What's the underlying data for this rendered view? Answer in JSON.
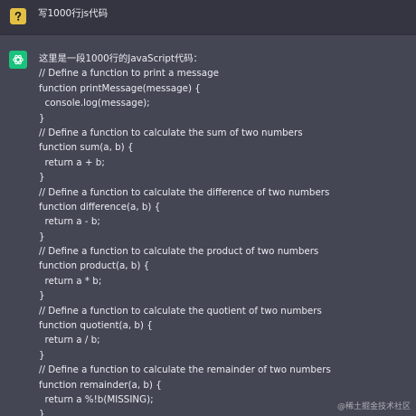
{
  "user_message": {
    "avatar_icon": "question-icon",
    "avatar_color": "#e2c044",
    "text": "写1000行js代码"
  },
  "assistant_message": {
    "avatar_icon": "openai-logo-icon",
    "avatar_color": "#19c37d",
    "intro": "这里是一段1000行的JavaScript代码：",
    "code_lines": [
      "// Define a function to print a message",
      "function printMessage(message) {",
      "  console.log(message);",
      "}",
      "// Define a function to calculate the sum of two numbers",
      "function sum(a, b) {",
      "  return a + b;",
      "}",
      "// Define a function to calculate the difference of two numbers",
      "function difference(a, b) {",
      "  return a - b;",
      "}",
      "// Define a function to calculate the product of two numbers",
      "function product(a, b) {",
      "  return a * b;",
      "}",
      "// Define a function to calculate the quotient of two numbers",
      "function quotient(a, b) {",
      "  return a / b;",
      "}",
      "// Define a function to calculate the remainder of two numbers",
      "function remainder(a, b) {",
      "  return a %!b(MISSING);",
      "}"
    ]
  },
  "watermark": "@稀土掘金技术社区"
}
